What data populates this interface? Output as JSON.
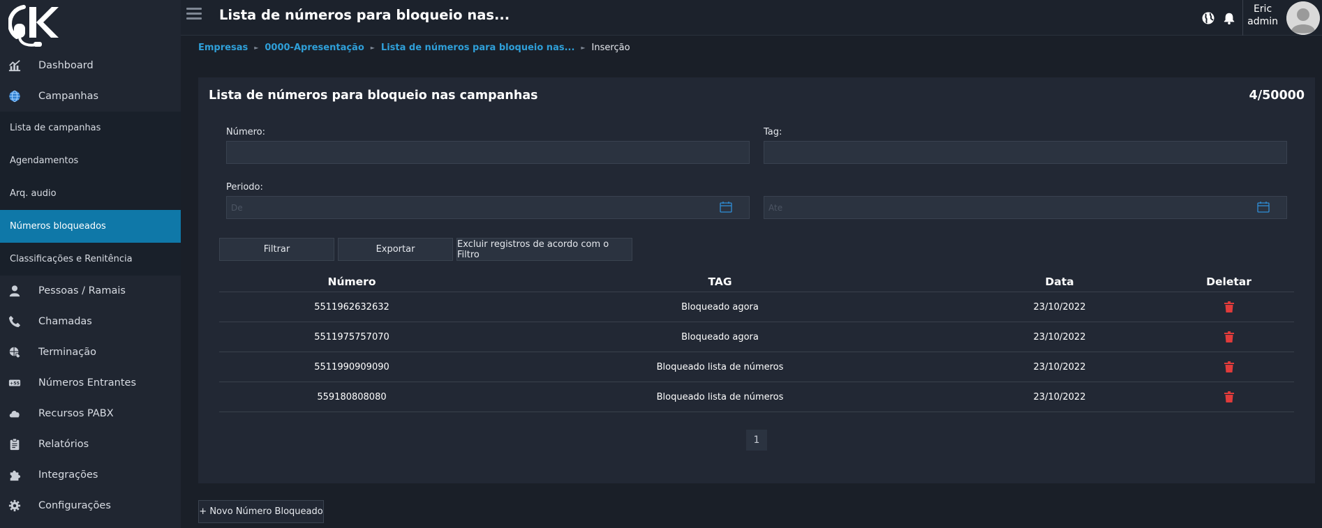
{
  "app": {
    "page_title": "Lista de números para bloqueio nas..."
  },
  "topbar": {
    "icons": [
      "globe-icon",
      "bell-icon"
    ],
    "user_name": "Eric",
    "user_role": "admin"
  },
  "sidebar": {
    "items_top": [
      {
        "label": "Dashboard",
        "icon": "chart-icon"
      },
      {
        "label": "Campanhas",
        "icon": "globe-icon"
      }
    ],
    "submenu": [
      {
        "label": "Lista de campanhas"
      },
      {
        "label": "Agendamentos"
      },
      {
        "label": "Arq. audio"
      },
      {
        "label": "Números bloqueados",
        "active": true
      },
      {
        "label": "Classificações e Renitência"
      }
    ],
    "items_bottom": [
      {
        "label": "Pessoas / Ramais",
        "icon": "user-icon"
      },
      {
        "label": "Chamadas",
        "icon": "phone-icon"
      },
      {
        "label": "Terminação",
        "icon": "globe-phone-icon"
      },
      {
        "label": "Números Entrantes",
        "icon": "number-badge-icon"
      },
      {
        "label": "Recursos PABX",
        "icon": "cloud-icon"
      },
      {
        "label": "Relatórios",
        "icon": "clipboard-icon"
      },
      {
        "label": "Integrações",
        "icon": "puzzle-icon"
      },
      {
        "label": "Configurações",
        "icon": "gear-icon"
      }
    ]
  },
  "breadcrumb": {
    "items": [
      "Empresas",
      "0000-Apresentação",
      "Lista de números para bloqueio nas..."
    ],
    "current": "Inserção"
  },
  "card": {
    "title": "Lista de números para bloqueio nas campanhas",
    "count": "4/50000"
  },
  "filters": {
    "numero_label": "Número:",
    "numero_value": "",
    "tag_label": "Tag:",
    "tag_value": "",
    "periodo_label": "Periodo:",
    "de_placeholder": "De",
    "ate_placeholder": "Ate"
  },
  "buttons": {
    "filtrar": "Filtrar",
    "exportar": "Exportar",
    "excluir": "Excluir registros de acordo com o Filtro",
    "novo": "+ Novo Número Bloqueado"
  },
  "table": {
    "headers": [
      "Número",
      "TAG",
      "Data",
      "Deletar"
    ],
    "rows": [
      {
        "numero": "5511962632632",
        "tag": "Bloqueado agora",
        "data": "23/10/2022"
      },
      {
        "numero": "5511975757070",
        "tag": "Bloqueado agora",
        "data": "23/10/2022"
      },
      {
        "numero": "5511990909090",
        "tag": "Bloqueado lista de números",
        "data": "23/10/2022"
      },
      {
        "numero": "559180808080",
        "tag": "Bloqueado lista de números",
        "data": "23/10/2022"
      }
    ]
  },
  "pagination": {
    "current_page": "1"
  },
  "colors": {
    "accent": "#0f78a8",
    "link": "#2f9fd8",
    "delete": "#e03b3b",
    "background": "#1a1f28",
    "sidebar": "#202631"
  }
}
